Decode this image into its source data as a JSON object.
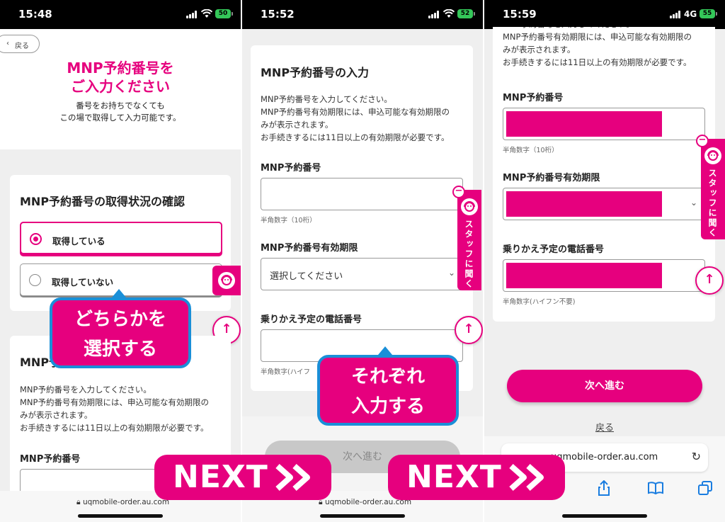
{
  "colors": {
    "accent": "#e6007e",
    "callout_border": "#1a8fd8",
    "battery": "#34c759"
  },
  "panel1": {
    "status": {
      "time": "15:48",
      "battery": "50"
    },
    "back_label": "戻る",
    "hero": {
      "title_line1": "MNP予約番号を",
      "title_line2": "ご入力ください",
      "sub_line1": "番号をお持ちでなくても",
      "sub_line2": "この場で取得して入力可能です。"
    },
    "status_card": {
      "title": "MNP予約番号の取得状況の確認",
      "option_yes": "取得している",
      "option_no": "取得していない"
    },
    "input_card": {
      "title": "MNP予約番号の入力",
      "desc_line1": "MNP予約番号を入力してください。",
      "desc_line2": "MNP予約番号有効期限には、申込可能な有効期限の",
      "desc_line3": "みが表示されます。",
      "desc_line4": "お手続きするには11日以上の有効期限が必要です。",
      "field_label": "MNP予約番号"
    },
    "callout_line1": "どちらかを",
    "callout_line2": "選択する",
    "url": "uqmobile-order.au.com"
  },
  "panel2": {
    "status": {
      "time": "15:52",
      "battery": "52"
    },
    "card": {
      "title": "MNP予約番号の入力",
      "desc_line1": "MNP予約番号を入力してください。",
      "desc_line2": "MNP予約番号有効期限には、申込可能な有効期限の",
      "desc_line3": "みが表示されます。",
      "desc_line4": "お手続きするには11日以上の有効期限が必要です。",
      "number_label": "MNP予約番号",
      "number_hint": "半角数字（10桁）",
      "expiry_label": "MNP予約番号有効期限",
      "expiry_placeholder": "選択してください",
      "phone_label": "乗りかえ予定の電話番号",
      "phone_hint": "半角数字(ハイフ"
    },
    "staff_label": "スタッフに聞く",
    "callout_line1": "それぞれ",
    "callout_line2": "入力する",
    "next_button": "次へ進む",
    "url": "uqmobile-order.au.com"
  },
  "panel3": {
    "status": {
      "time": "15:59",
      "network": "4G",
      "battery": "55"
    },
    "card": {
      "desc_line1": "MNP予約番号を入力してください。",
      "desc_line2": "MNP予約番号有効期限には、申込可能な有効期限の",
      "desc_line3": "みが表示されます。",
      "desc_line4": "お手続きするには11日以上の有効期限が必要です。",
      "number_label": "MNP予約番号",
      "number_hint": "半角数字（10桁）",
      "expiry_label": "MNP予約番号有効期限",
      "phone_label": "乗りかえ予定の電話番号",
      "phone_hint": "半角数字(ハイフン不要)"
    },
    "staff_label": "スタッフに聞く",
    "next_button": "次へ進む",
    "back_link": "戻る",
    "url": "uqmobile-order.au.com"
  },
  "next_badges": [
    {
      "label": "NEXT"
    },
    {
      "label": "NEXT"
    }
  ]
}
